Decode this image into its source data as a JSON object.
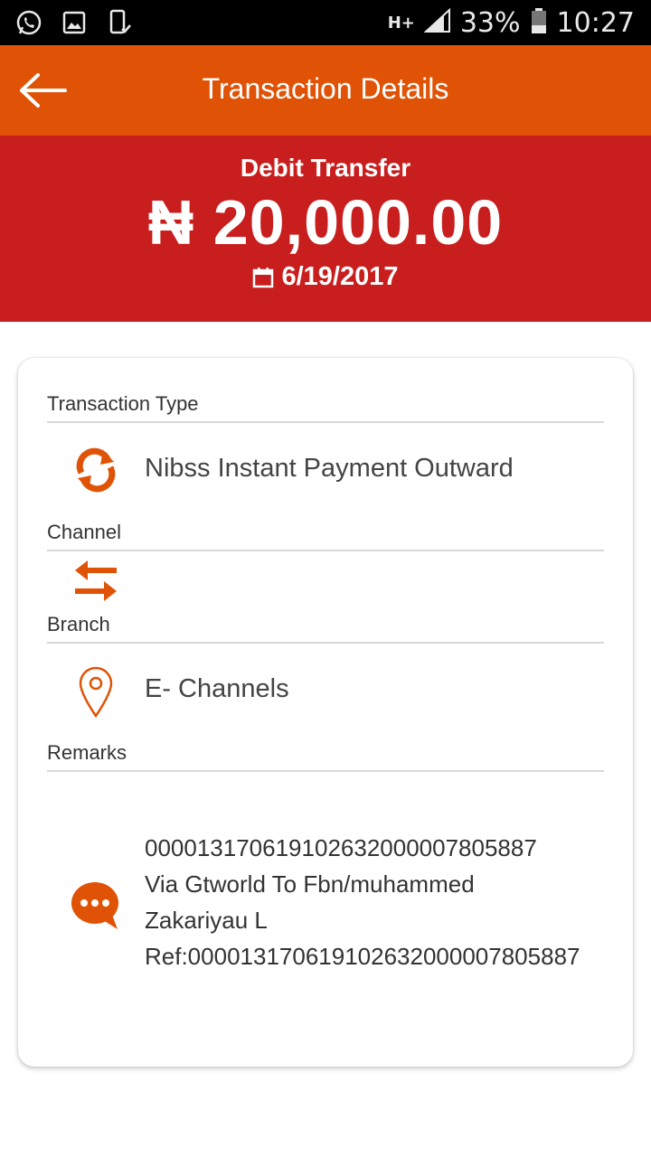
{
  "status_bar": {
    "left_icons": [
      "whatsapp-icon",
      "gallery-icon",
      "phone-check-icon"
    ],
    "network": "H+",
    "battery_percent": "33%",
    "time": "10:27"
  },
  "app_bar": {
    "title": "Transaction Details",
    "back_icon": "arrow-left-icon",
    "color": "#e05306"
  },
  "summary": {
    "type": "Debit Transfer",
    "amount": "₦ 20,000.00",
    "date": "6/19/2017",
    "color": "#c91e1e"
  },
  "details": {
    "transaction_type": {
      "label": "Transaction Type",
      "value": "Nibss Instant Payment Outward",
      "icon": "refresh-icon"
    },
    "channel": {
      "label": "Channel",
      "value": "",
      "icon": "transfer-arrows-icon"
    },
    "branch": {
      "label": "Branch",
      "value": "E- Channels",
      "icon": "location-pin-icon"
    },
    "remarks": {
      "label": "Remarks",
      "value": "000013170619102632000007805887\nVia Gtworld To Fbn/muhammed\nZakariyau L\nRef:00001317061910263200000780588​7",
      "icon": "chat-bubble-icon"
    }
  }
}
